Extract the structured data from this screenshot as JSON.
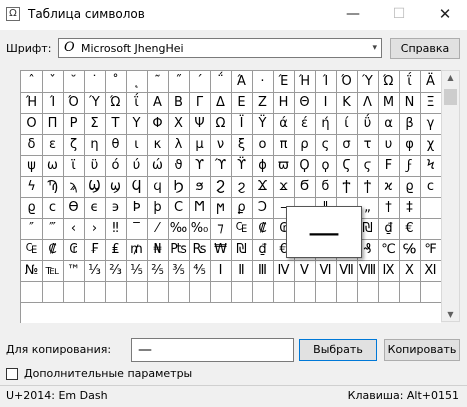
{
  "window": {
    "title": "Таблица символов",
    "minimize_glyph": "—",
    "maximize_glyph": "☐",
    "close_glyph": "✕",
    "app_icon_glyph": "Ω"
  },
  "font": {
    "label": "Шрифт:",
    "icon_glyph": "O",
    "selected": "Microsoft JhengHei",
    "dropdown_glyph": "▾",
    "help_label": "Справка"
  },
  "grid": {
    "rows": [
      [
        "ˆ",
        "ˇ",
        "˘",
        "˙",
        "˚",
        "˛",
        "˜",
        "˝",
        "΄",
        "΅",
        "Ά",
        "·",
        "Έ",
        "Ή",
        "Ί",
        "Ό",
        "Ύ",
        "Ώ",
        "ΐ",
        "Ä",
        "Έ"
      ],
      [
        "Ή",
        "Ί",
        "Ό",
        "Ύ",
        "Ώ",
        "ΐ",
        "Α",
        "Β",
        "Γ",
        "Δ",
        "Ε",
        "Ζ",
        "Η",
        "Θ",
        "Ι",
        "Κ",
        "Λ",
        "Μ",
        "Ν",
        "Ξ"
      ],
      [
        "Ο",
        "Π",
        "Ρ",
        "Σ",
        "Τ",
        "Υ",
        "Φ",
        "Χ",
        "Ψ",
        "Ω",
        "Ϊ",
        "Ϋ",
        "ά",
        "έ",
        "ή",
        "ί",
        "ΰ",
        "α",
        "β",
        "γ"
      ],
      [
        "δ",
        "ε",
        "ζ",
        "η",
        "θ",
        "ι",
        "κ",
        "λ",
        "μ",
        "ν",
        "ξ",
        "ο",
        "π",
        "ρ",
        "ς",
        "σ",
        "τ",
        "υ",
        "φ",
        "χ"
      ],
      [
        "ψ",
        "ω",
        "ϊ",
        "ϋ",
        "ό",
        "ύ",
        "ώ",
        "ϑ",
        "ϒ",
        "ϓ",
        "ϔ",
        "ϕ",
        "ϖ",
        "Ϙ",
        "ϙ",
        "Ϛ",
        "ϛ",
        "Ϝ",
        "ϝ",
        "Ϟ"
      ],
      [
        "ϟ",
        "Ϡ",
        "ϡ",
        "Ϣ",
        "ϣ",
        "Ϥ",
        "ϥ",
        "Ϧ",
        "ϧ",
        "Ϩ",
        "ϩ",
        "Ϫ",
        "ϫ",
        "Ϭ",
        "ϭ",
        "Ϯ",
        "ϯ",
        "ϰ",
        "ϱ",
        "ϲ"
      ],
      [
        "ϱ",
        "ϲ",
        "ϴ",
        "ϵ",
        "϶",
        "Ϸ",
        "ϸ",
        "Ϲ",
        "Ϻ",
        "ϻ",
        "ϼ",
        "Ͻ",
        "–",
        "—",
        "‖",
        "‗",
        "„",
        "†",
        "‡",
        ""
      ],
      [
        "″",
        "‴",
        "‹",
        "›",
        "‼",
        "‾",
        "⁄",
        "‰",
        "%₀",
        "⁊",
        "₠",
        "₡",
        "₢",
        "₣",
        "₤",
        "₧",
        "₪",
        "₫",
        "€",
        ""
      ],
      [
        "₠",
        "₡",
        "₢",
        "₣",
        "₤",
        "₥",
        "₦",
        "₧",
        "₨",
        "₩",
        "₪",
        "₫",
        "€",
        "₭",
        "₮",
        "₯",
        "₰",
        "℃",
        "℅",
        "℉"
      ],
      [
        "№",
        "℡",
        "™",
        "⅓",
        "⅔",
        "⅕",
        "⅖",
        "⅗",
        "⅘",
        "Ⅰ",
        "Ⅱ",
        "Ⅲ",
        "Ⅳ",
        "Ⅴ",
        "Ⅵ",
        "Ⅶ",
        "Ⅷ",
        "Ⅸ",
        "Ⅹ",
        "Ⅺ"
      ],
      [
        "",
        "",
        "",
        "",
        "",
        "",
        "",
        "",
        "",
        "",
        "",
        "",
        "",
        "",
        "",
        "",
        "",
        "",
        "",
        "",
        ""
      ]
    ]
  },
  "magnifier": {
    "char": "—"
  },
  "copy": {
    "label": "Для копирования:",
    "value": "—",
    "select_label": "Выбрать",
    "copy_label": "Копировать"
  },
  "advanced": {
    "label": "Дополнительные параметры",
    "checked": false
  },
  "status": {
    "char_info": "U+2014: Em Dash",
    "shortcut": "Клавиша: Alt+0151"
  }
}
